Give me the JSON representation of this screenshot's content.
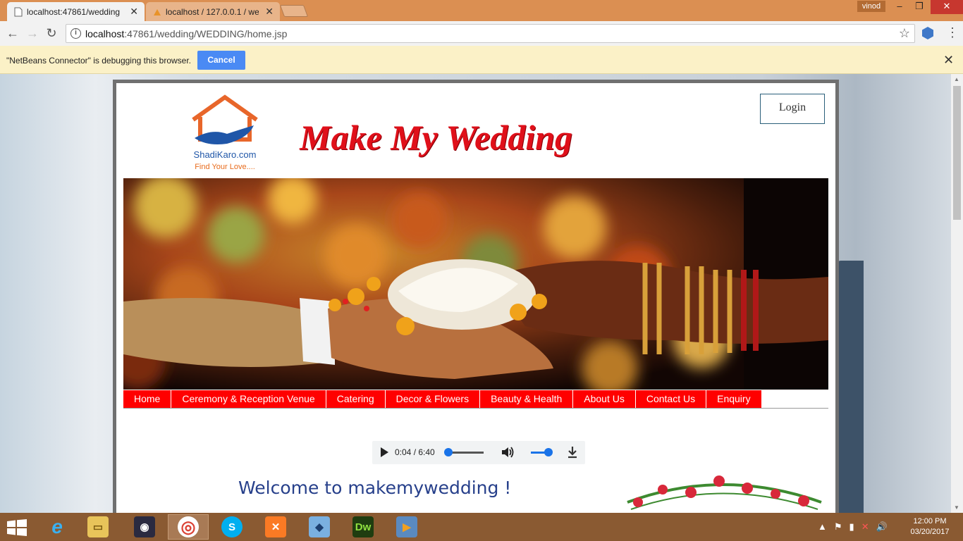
{
  "browser": {
    "tabs": [
      {
        "title": "localhost:47861/wedding",
        "active": true
      },
      {
        "title": "localhost / 127.0.0.1 / we",
        "active": false
      }
    ],
    "user": "vinod",
    "url_host": "localhost",
    "url_rest": ":47861/wedding/WEDDING/home.jsp",
    "infobar_message": "\"NetBeans Connector\" is debugging this browser.",
    "infobar_cancel": "Cancel"
  },
  "page": {
    "logo_brand": "ShadiKaro.com",
    "logo_tagline": "Find Your Love....",
    "title": "Make My Wedding",
    "login_label": "Login",
    "nav": [
      "Home",
      "Ceremony & Reception Venue",
      "Catering",
      "Decor & Flowers",
      "Beauty & Health",
      "About Us",
      "Contact Us",
      "Enquiry"
    ],
    "audio": {
      "current": "0:04",
      "duration": "6:40",
      "progress": 0.01,
      "volume": 1.0
    },
    "welcome": "Welcome to makemywedding !"
  },
  "taskbar": {
    "apps": [
      "internet-explorer",
      "file-explorer",
      "media-center",
      "chrome",
      "skype",
      "xampp",
      "virtualbox",
      "dreamweaver",
      "media-player"
    ],
    "active_app": "chrome",
    "time": "12:00 PM",
    "date": "03/20/2017"
  },
  "colors": {
    "tabstrip": "#db8f52",
    "nav_bg": "#ff0000",
    "title": "#e0101a",
    "welcome": "#27408b",
    "taskbar": "#8a5a32"
  }
}
